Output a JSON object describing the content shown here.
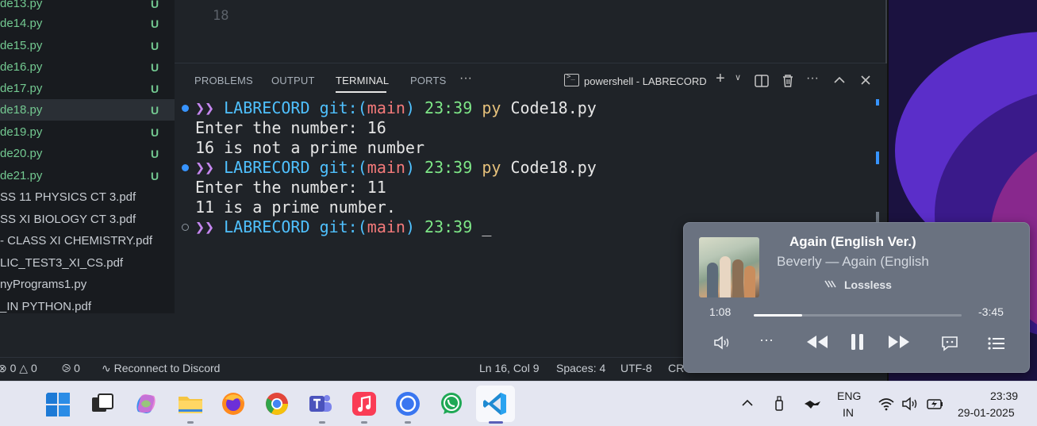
{
  "explorer": {
    "files": [
      {
        "name": "de13.py",
        "status": "U"
      },
      {
        "name": "de14.py",
        "status": "U"
      },
      {
        "name": "de15.py",
        "status": "U"
      },
      {
        "name": "de16.py",
        "status": "U"
      },
      {
        "name": "de17.py",
        "status": "U"
      },
      {
        "name": "de18.py",
        "status": "U"
      },
      {
        "name": "de19.py",
        "status": "U"
      },
      {
        "name": "de20.py",
        "status": "U"
      },
      {
        "name": "de21.py",
        "status": "U"
      },
      {
        "name": "SS 11 PHYSICS CT 3.pdf",
        "status": ""
      },
      {
        "name": "SS XI BIOLOGY  CT 3.pdf",
        "status": ""
      },
      {
        "name": "- CLASS  XI CHEMISTRY.pdf",
        "status": ""
      },
      {
        "name": "LIC_TEST3_XI_CS.pdf",
        "status": ""
      },
      {
        "name": "nyPrograms1.py",
        "status": ""
      },
      {
        "name": "_IN PYTHON.pdf",
        "status": ""
      }
    ]
  },
  "editor": {
    "line_number": "18"
  },
  "panel": {
    "tabs": [
      "PROBLEMS",
      "OUTPUT",
      "TERMINAL",
      "PORTS"
    ],
    "active_tab": "TERMINAL",
    "more": "···",
    "terminal_name": "powershell - LABRECORD",
    "prompt_arrow": "❯❯",
    "prompt_dir": "LABRECORD",
    "prompt_git": "git:(",
    "prompt_branch": "main",
    "prompt_git_close": ")",
    "session": [
      {
        "time": "23:39",
        "cmd": "py",
        "arg": "Code18.py",
        "output": [
          "Enter the number: 16",
          "16 is not a prime number"
        ]
      },
      {
        "time": "23:39",
        "cmd": "py",
        "arg": "Code18.py",
        "output": [
          "Enter the number: 11",
          "11 is a prime number."
        ]
      },
      {
        "time": "23:39",
        "cmd": "",
        "arg": "_",
        "output": []
      }
    ]
  },
  "statusbar": {
    "errors": "0",
    "warnings": "0",
    "ports": "0",
    "discord": "Reconnect to Discord",
    "position": "Ln 16, Col 9",
    "spaces": "Spaces: 4",
    "encoding": "UTF-8",
    "eol": "CR"
  },
  "media": {
    "title": "Again (English Ver.)",
    "subtitle": "Beverly — Again (English",
    "badge": "Lossless",
    "elapsed": "1:08",
    "remaining": "-3:45",
    "progress": 0.232
  },
  "taskbar": {
    "apps": [
      "windows-start",
      "task-view",
      "copilot",
      "file-explorer",
      "firefox",
      "chrome",
      "teams",
      "apple-music",
      "signal",
      "whatsapp",
      "vscode"
    ],
    "language_top": "ENG",
    "language_bottom": "IN",
    "time": "23:39",
    "date": "29-01-2025"
  },
  "colors": {
    "untracked_green": "#73c991",
    "terminal_bg": "#1f2328",
    "prompt_purple": "#c586f0",
    "prompt_cyan": "#4fc1ff",
    "branch_red": "#f47a7a",
    "time_green": "#7ee787",
    "cmd_yellow": "#e5c07b"
  }
}
